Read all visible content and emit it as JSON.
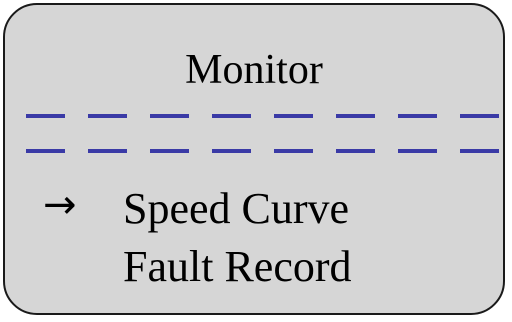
{
  "screen": {
    "title": "Monitor",
    "menu": {
      "items": [
        {
          "label": "Speed Curve",
          "selected": true
        },
        {
          "label": "Fault Record",
          "selected": false
        }
      ],
      "cursor_glyph": "→"
    }
  },
  "colors": {
    "panel_background": "#d6d6d6",
    "panel_border": "#1a1a1a",
    "divider": "#3a3aa6",
    "text": "#000000"
  },
  "icons": {
    "cursor": "right-arrow-icon"
  }
}
